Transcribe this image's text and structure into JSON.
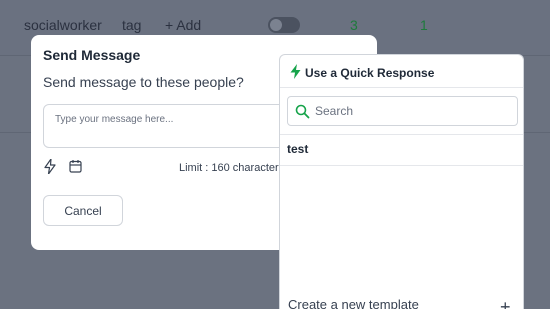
{
  "background": {
    "row": {
      "col1": "socialworker",
      "col2": "tag",
      "col3": "+ Add",
      "col4": "3",
      "col5": "1"
    }
  },
  "send_modal": {
    "title": "Send Message",
    "subtitle": "Send message to these people?",
    "message_placeholder": "Type your message here...",
    "limit_text": "Limit : 160 character",
    "cancel_label": "Cancel",
    "icons": [
      "bolt-icon",
      "calendar-icon"
    ]
  },
  "quick_response": {
    "title": "Use a Quick Response",
    "search_placeholder": "Search",
    "items": [
      "test"
    ],
    "create_label": "Create a new template",
    "create_icon": "+"
  },
  "colors": {
    "accent_green": "#16a34a",
    "overlay": "#6b7280"
  }
}
